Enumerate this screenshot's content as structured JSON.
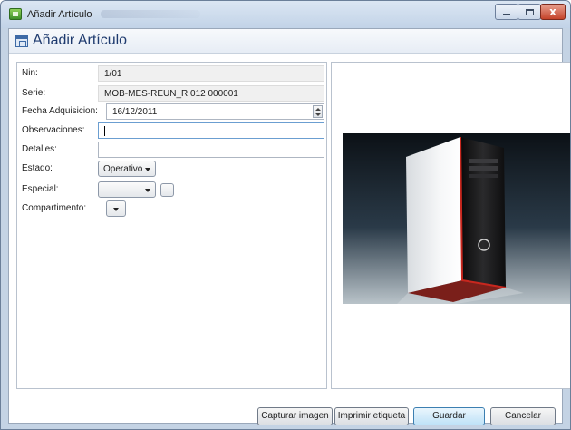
{
  "window": {
    "title": "Añadir Artículo",
    "close_glyph": "x"
  },
  "form": {
    "header_title": "Añadir Artículo",
    "fields": {
      "nin": {
        "label": "Nin:",
        "value": "1/01"
      },
      "serie": {
        "label": "Serie:",
        "value": "MOB-MES-REUN_R 012 000001"
      },
      "fecha": {
        "label": "Fecha Adquisicion:",
        "value": "16/12/2011"
      },
      "observaciones": {
        "label": "Observaciones:",
        "value": ""
      },
      "detalles": {
        "label": "Detalles:",
        "value": ""
      },
      "estado": {
        "label": "Estado:",
        "value": "Operativo"
      },
      "especial": {
        "label": "Especial:",
        "value": "",
        "browse_label": "..."
      },
      "compartimento": {
        "label": "Compartimento:",
        "value": ""
      }
    }
  },
  "buttons": {
    "capturar": "Capturar imagen",
    "imprimir": "Imprimir etiqueta",
    "guardar": "Guardar",
    "cancelar": "Cancelar"
  },
  "icons": {
    "app": "app-icon",
    "header": "form-icon",
    "spinner": "spinner-icon",
    "dropdown": "chevron-down-icon"
  }
}
